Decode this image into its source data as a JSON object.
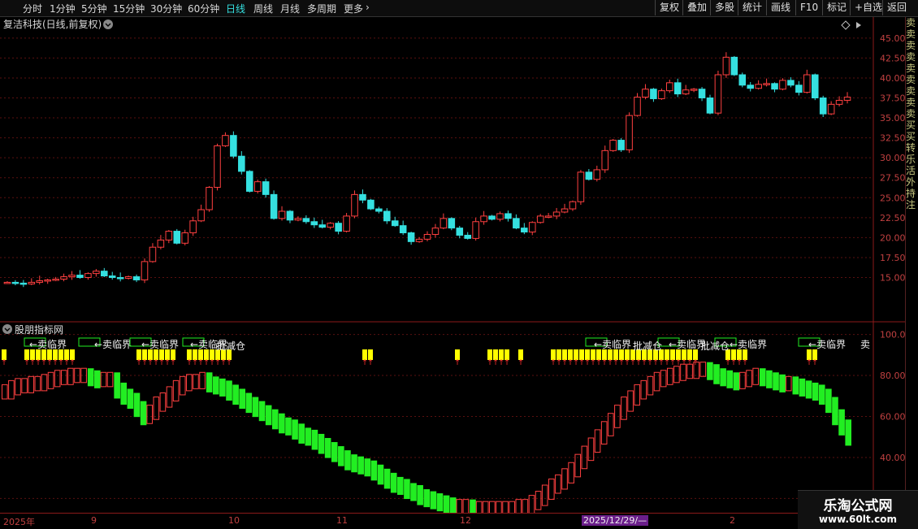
{
  "toolbar": {
    "periods": [
      "分时",
      "1分钟",
      "5分钟",
      "15分钟",
      "30分钟",
      "60分钟",
      "日线",
      "周线",
      "月线",
      "多周期",
      "更多"
    ],
    "active_period": "日线",
    "right_buttons": [
      "复权",
      "叠加",
      "多股",
      "统计",
      "画线",
      "F10",
      "标记",
      "+自选",
      "返回"
    ]
  },
  "main_chart": {
    "title": "复洁科技(日线,前复权)",
    "y_ticks": [
      "45.00",
      "42.50",
      "40.00",
      "37.50",
      "35.00",
      "32.50",
      "30.00",
      "27.50",
      "25.00",
      "22.50",
      "20.00",
      "17.50",
      "15.00"
    ]
  },
  "indicator": {
    "title": "股朋指标网",
    "y_ticks": [
      "100.0",
      "80.00",
      "60.00",
      "40.00",
      "20.00"
    ],
    "sell_label": "←卖临界",
    "reduce_label": "批减仓",
    "tail_label": "卖"
  },
  "x_axis": {
    "labels": [
      "2025年",
      "9",
      "10",
      "11",
      "12",
      "2025/12/29/—",
      "2"
    ]
  },
  "right_panel": {
    "text": "卖卖卖卖卖卖卖卖卖买买转乐活外持注"
  },
  "logo": {
    "name": "乐淘公式网",
    "url": "www.60lt.com"
  },
  "colors": {
    "up": "#ff4040",
    "down": "#35e0e0",
    "green_bar": "#22ee22",
    "yellow": "#ffff00",
    "grid": "#5a1010"
  },
  "chart_data": {
    "type": "candlestick",
    "price_series": [
      14.4,
      14.3,
      14.2,
      14.4,
      14.6,
      14.7,
      14.8,
      15.1,
      15.3,
      15.0,
      15.5,
      15.8,
      15.2,
      15.0,
      14.9,
      15.1,
      14.7,
      17.0,
      18.8,
      19.7,
      20.8,
      19.3,
      20.6,
      22.1,
      23.5,
      26.3,
      31.5,
      32.8,
      30.2,
      28.3,
      25.8,
      27.0,
      25.4,
      22.4,
      23.3,
      22.2,
      22.4,
      22.0,
      21.6,
      21.3,
      21.8,
      20.8,
      22.7,
      25.4,
      24.7,
      23.6,
      23.3,
      22.1,
      21.5,
      20.6,
      19.5,
      19.8,
      20.4,
      21.2,
      22.4,
      21.2,
      20.3,
      19.9,
      22.0,
      22.7,
      22.3,
      23.0,
      22.4,
      21.2,
      20.7,
      21.9,
      22.7,
      22.7,
      23.2,
      23.6,
      24.5,
      28.2,
      27.3,
      28.5,
      30.9,
      32.2,
      31.0,
      35.3,
      37.6,
      38.6,
      37.4,
      38.4,
      39.4,
      38.0,
      38.5,
      38.6,
      37.5,
      35.6,
      40.4,
      42.6,
      40.4,
      39.1,
      38.7,
      39.2,
      39.3,
      38.6,
      39.7,
      39.1,
      38.2,
      40.4,
      37.5,
      35.5,
      36.7,
      37.2,
      37.6
    ],
    "indicator_series": [
      74,
      76,
      77,
      77,
      78,
      78,
      79,
      80,
      81,
      81,
      82,
      82,
      82,
      81,
      80,
      80,
      80,
      75,
      72,
      70,
      66,
      62,
      64,
      68,
      70,
      73,
      76,
      78,
      79,
      79,
      80,
      78,
      77,
      76,
      74,
      72,
      70,
      68,
      66,
      64,
      62,
      60,
      58,
      57,
      55,
      53,
      52,
      50,
      48,
      46,
      44,
      42,
      40,
      39,
      38,
      37,
      35,
      33,
      31,
      29,
      28,
      26,
      25,
      23,
      22,
      21,
      20,
      19,
      18,
      18,
      18,
      17,
      17,
      17,
      17,
      17,
      17,
      17,
      18,
      18,
      20,
      22,
      25,
      28,
      30,
      33,
      36,
      40,
      44,
      48,
      52,
      56,
      60,
      64,
      68,
      71,
      74,
      76,
      78,
      80,
      81,
      82,
      83,
      84,
      84,
      85,
      85,
      84,
      82,
      81,
      80,
      79,
      80,
      81,
      82,
      81,
      80,
      79,
      78,
      78,
      77,
      76,
      75,
      74,
      72,
      68,
      62,
      57,
      52
    ],
    "ylim_price": [
      12,
      46
    ],
    "ylim_indicator": [
      15,
      105
    ]
  }
}
